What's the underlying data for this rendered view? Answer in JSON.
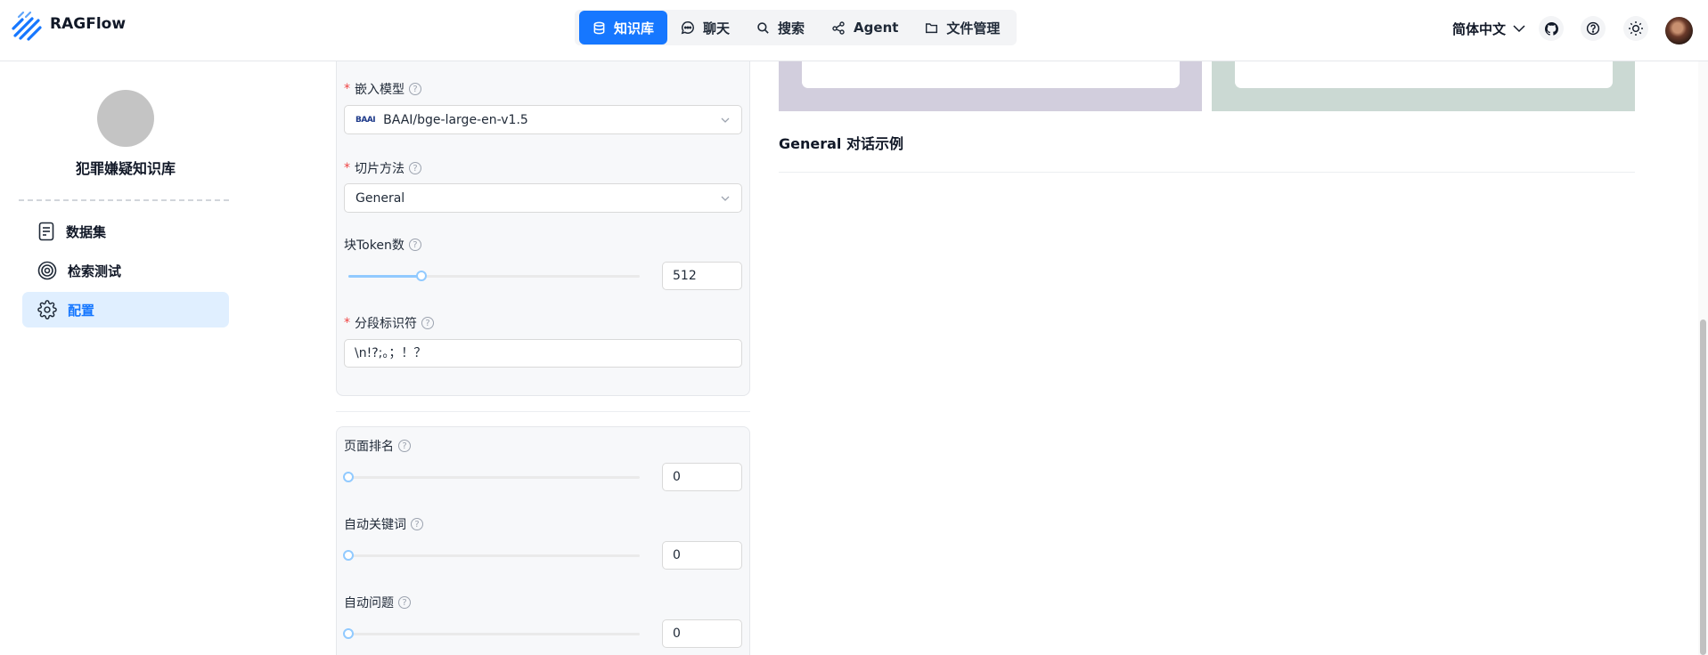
{
  "header": {
    "brand": "RAGFlow",
    "nav": [
      {
        "label": "知识库",
        "icon": "database-icon",
        "active": true
      },
      {
        "label": "聊天",
        "icon": "chat-icon",
        "active": false
      },
      {
        "label": "搜索",
        "icon": "search-icon",
        "active": false
      },
      {
        "label": "Agent",
        "icon": "agent-icon",
        "active": false
      },
      {
        "label": "文件管理",
        "icon": "folder-icon",
        "active": false
      }
    ],
    "language": "简体中文",
    "accent_color": "#1677ff"
  },
  "sidebar": {
    "kb_name": "犯罪嫌疑知识库",
    "items": [
      {
        "label": "数据集",
        "icon": "document-icon",
        "active": false
      },
      {
        "label": "检索测试",
        "icon": "target-icon",
        "active": false
      },
      {
        "label": "配置",
        "icon": "gear-icon",
        "active": true
      }
    ]
  },
  "form": {
    "embedding_model": {
      "label": "嵌入模型",
      "value": "BAAI/bge-large-en-v1.5",
      "logo_text": "BAAI"
    },
    "chunk_method": {
      "label": "切片方法",
      "value": "General"
    },
    "chunk_token": {
      "label": "块Token数",
      "value": "512",
      "fraction": 0.25
    },
    "delimiter": {
      "label": "分段标识符",
      "value": "\\n!?;。；！？"
    },
    "page_rank": {
      "label": "页面排名",
      "value": "0",
      "fraction": 0
    },
    "auto_keywords": {
      "label": "自动关键词",
      "value": "0",
      "fraction": 0
    },
    "auto_questions": {
      "label": "自动问题",
      "value": "0",
      "fraction": 0
    }
  },
  "preview": {
    "title": "General 对话示例"
  }
}
